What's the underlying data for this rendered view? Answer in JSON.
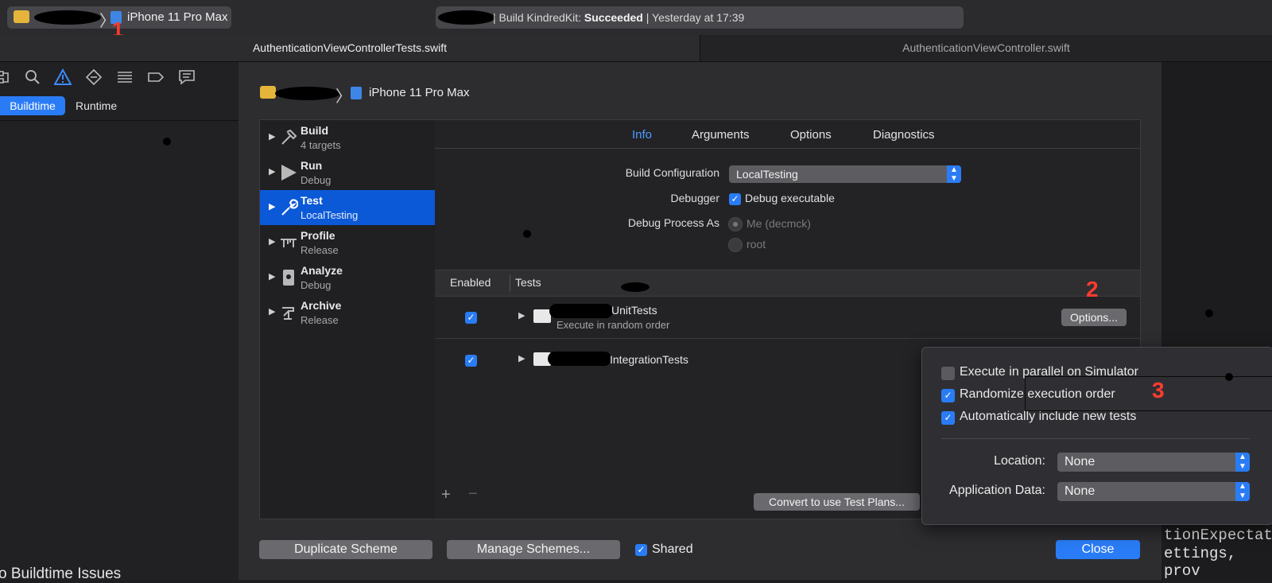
{
  "toolbar": {
    "scheme_device": "iPhone 11 Pro Max",
    "activity_text": "| Build KindredKit: ",
    "activity_status": "Succeeded",
    "activity_time": " | Yesterday at 17:39"
  },
  "tabs": {
    "left": "AuthenticationViewControllerTests.swift",
    "right": "AuthenticationViewController.swift"
  },
  "navigator": {
    "segments": [
      "Buildtime",
      "Runtime"
    ],
    "bottom_text": "o Buildtime Issues"
  },
  "editor": {
    "lines": [
      "tionExpectati",
      "ettings, prov"
    ]
  },
  "sheet": {
    "device": "iPhone 11 Pro Max",
    "actions": [
      {
        "title": "Build",
        "subtitle": "4 targets",
        "icon": "hammer-icon"
      },
      {
        "title": "Run",
        "subtitle": "Debug",
        "icon": "play-icon"
      },
      {
        "title": "Test",
        "subtitle": "LocalTesting",
        "icon": "wrench-icon"
      },
      {
        "title": "Profile",
        "subtitle": "Release",
        "icon": "caliper-icon"
      },
      {
        "title": "Analyze",
        "subtitle": "Debug",
        "icon": "analyze-icon"
      },
      {
        "title": "Archive",
        "subtitle": "Release",
        "icon": "archive-icon"
      }
    ],
    "tabs": [
      "Info",
      "Arguments",
      "Options",
      "Diagnostics"
    ],
    "build_configuration_label": "Build Configuration",
    "build_configuration_value": "LocalTesting",
    "debugger_label": "Debugger",
    "debugger_value": "Debug executable",
    "debug_process_label": "Debug Process As",
    "debug_process_options": [
      "Me (decmck)",
      "root"
    ],
    "table": {
      "headers": [
        "Enabled",
        "Tests"
      ],
      "rows": [
        {
          "name": "UnitTests",
          "detail": "Execute in random order"
        },
        {
          "name": "IntegrationTests",
          "detail": ""
        }
      ]
    },
    "options_button": "Options...",
    "convert_button": "Convert to use Test Plans...",
    "duplicate_button": "Duplicate Scheme",
    "manage_button": "Manage Schemes...",
    "shared_label": "Shared",
    "close_button": "Close"
  },
  "popover": {
    "options": [
      {
        "label": "Execute in parallel on Simulator",
        "checked": false
      },
      {
        "label": "Randomize execution order",
        "checked": true
      },
      {
        "label": "Automatically include new tests",
        "checked": true
      }
    ],
    "location_label": "Location:",
    "location_value": "None",
    "appdata_label": "Application Data:",
    "appdata_value": "None"
  },
  "annotations": [
    "1",
    "2",
    "3"
  ],
  "colors": {
    "accent": "#2a7cf6",
    "selection": "#0b59d7",
    "annotation": "#ff3b30"
  }
}
